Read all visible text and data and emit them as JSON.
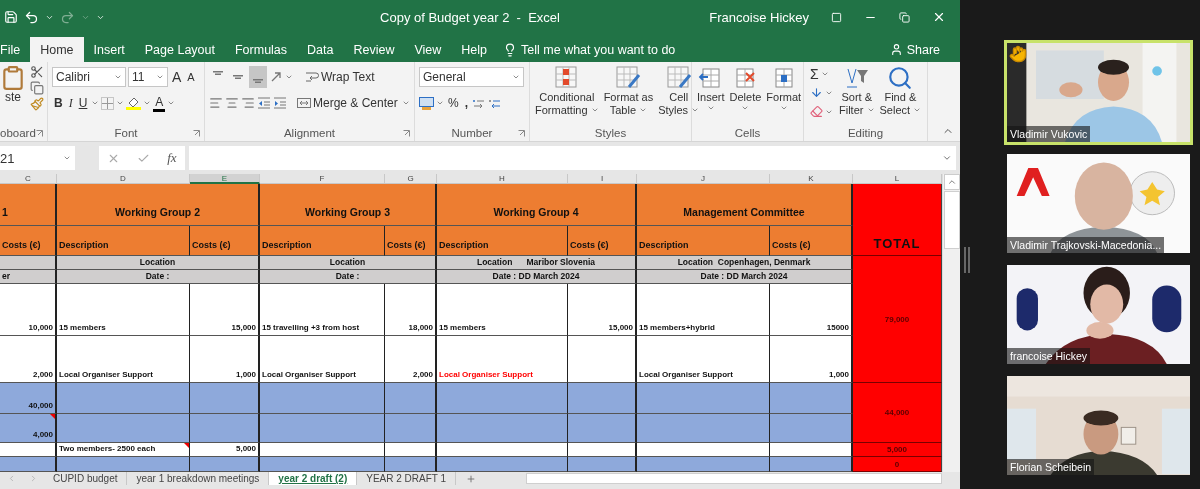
{
  "excel": {
    "title": "Copy of Budget year 2  -  Excel",
    "user": "Francoise Hickey",
    "tabs": [
      {
        "label": "File",
        "selected": false
      },
      {
        "label": "Home",
        "selected": true
      },
      {
        "label": "Insert",
        "selected": false
      },
      {
        "label": "Page Layout",
        "selected": false
      },
      {
        "label": "Formulas",
        "selected": false
      },
      {
        "label": "Data",
        "selected": false
      },
      {
        "label": "Review",
        "selected": false
      },
      {
        "label": "View",
        "selected": false
      },
      {
        "label": "Help",
        "selected": false
      }
    ],
    "tell_me": "Tell me what you want to do",
    "share": "Share",
    "ribbon": {
      "clipboard": {
        "paste": "ste",
        "label": "oboard"
      },
      "font": {
        "name": "Calibri",
        "size": "11",
        "grow": "A",
        "shrink": "A",
        "bold": "B",
        "italic": "I",
        "underline": "U",
        "color_letter": "A",
        "label": "Font"
      },
      "alignment": {
        "vertical": [
          {
            "selected": false
          },
          {
            "selected": false
          },
          {
            "selected": true
          }
        ],
        "wrap": "Wrap Text",
        "merge": "Merge & Center",
        "label": "Alignment"
      },
      "number": {
        "format": "General",
        "percent": "%",
        "comma": ",",
        "label": "Number"
      },
      "styles": {
        "buttons": [
          [
            "Conditional",
            "Formatting"
          ],
          [
            "Format as",
            "Table"
          ],
          [
            "Cell",
            "Styles"
          ]
        ],
        "label": "Styles"
      },
      "cells": {
        "buttons": [
          "Insert",
          "Delete",
          "Format"
        ],
        "label": "Cells"
      },
      "editing": {
        "sum": "Σ",
        "buttons": [
          [
            "Sort &",
            "Filter"
          ],
          [
            "Find &",
            "Select"
          ]
        ],
        "label": "Editing"
      }
    },
    "name_box": "21",
    "fx": "fx",
    "columns": [
      {
        "label": "C",
        "selected": false
      },
      {
        "label": "D",
        "selected": false
      },
      {
        "label": "E",
        "selected": true
      },
      {
        "label": "F",
        "selected": false
      },
      {
        "label": "G",
        "selected": false
      },
      {
        "label": "H",
        "selected": false
      },
      {
        "label": "I",
        "selected": false
      },
      {
        "label": "J",
        "selected": false
      },
      {
        "label": "K",
        "selected": false
      },
      {
        "label": "L",
        "selected": false
      }
    ],
    "rows": [
      {
        "kind": "titles",
        "lead": "1",
        "cells": [
          "Working Group 2",
          "Working Group 3",
          "Working Group 4",
          "Management Committee"
        ]
      },
      {
        "kind": "headings",
        "cells": [
          "Costs (€)",
          "Description",
          "Costs (€)",
          "Description",
          "Costs (€)",
          "Description",
          "Costs (€)",
          "Description",
          "Costs (€)"
        ]
      },
      {
        "kind": "spans",
        "cells": [
          "Location",
          "Location",
          "Location      Maribor Slovenia",
          "Location  Copenhagen, Denmark"
        ]
      },
      {
        "kind": "spans",
        "lead": "er",
        "cells": [
          "Date :",
          "Date :",
          "Date : DD March 2024",
          "Date : DD March 2024"
        ]
      },
      {
        "kind": "entries",
        "color": "#ffffff",
        "cells": [
          {
            "text": "10,000"
          },
          {
            "text": "15 members"
          },
          {
            "text": "15,000"
          },
          {
            "text": "15 travelling +3 from host"
          },
          {
            "text": "18,000"
          },
          {
            "text": "15 members"
          },
          {
            "text": "15,000"
          },
          {
            "text": "15 members+hybrid"
          },
          {
            "text": "15000"
          }
        ]
      },
      {
        "kind": "entries",
        "color": "#ffffff",
        "cells": [
          {
            "text": "2,000"
          },
          {
            "text": "Local Organiser Support"
          },
          {
            "text": "1,000"
          },
          {
            "text": "Local Organiser Support"
          },
          {
            "text": "2,000"
          },
          {
            "text": "Local Organiser Support",
            "color": "#ff0000"
          },
          {},
          {
            "text": "Local Organiser Support"
          },
          {
            "text": "1,000"
          }
        ]
      },
      {
        "kind": "entries",
        "color": "#8ea9db",
        "cells": [
          {
            "text": "40,000"
          },
          {},
          {},
          {},
          {},
          {},
          {},
          {},
          {}
        ]
      },
      {
        "kind": "entries",
        "color": "#8ea9db",
        "cells": [
          {
            "text": "4,000",
            "comment": true
          },
          {},
          {},
          {},
          {},
          {},
          {},
          {},
          {}
        ]
      },
      {
        "kind": "entries",
        "color": "#ffffff",
        "cells": [
          {},
          {
            "text": "Two members- 2500 each",
            "comment": true
          },
          {
            "text": "5,000"
          },
          {},
          {},
          {},
          {},
          {},
          {}
        ]
      },
      {
        "kind": "entries",
        "color": "#8ea9db",
        "cells": [
          {},
          {},
          {},
          {},
          {},
          {},
          {},
          {},
          {}
        ]
      }
    ],
    "totals": [
      "TOTAL",
      "79,000",
      "44,000",
      "5,000",
      "0"
    ],
    "sheets": [
      {
        "label": "CUPID budget",
        "selected": false
      },
      {
        "label": "year 1 breakdown meetings",
        "selected": false
      },
      {
        "label": "year 2 draft (2)",
        "selected": true
      },
      {
        "label": "YEAR 2 DRAFT 1",
        "selected": false
      }
    ]
  },
  "meeting": {
    "participants": [
      {
        "name": "Vladimir Vukovic",
        "speaking": true,
        "hand_raised": true,
        "kind": "picture"
      },
      {
        "name": "Vladimir Trajkovski-Macedonia...",
        "speaking": false,
        "hand_raised": false,
        "kind": "picture"
      },
      {
        "name": "francoise Hickey",
        "speaking": false,
        "hand_raised": false,
        "kind": "picture"
      },
      {
        "name": "Florian Scheibein",
        "speaking": false,
        "hand_raised": false,
        "kind": "picture"
      }
    ]
  }
}
